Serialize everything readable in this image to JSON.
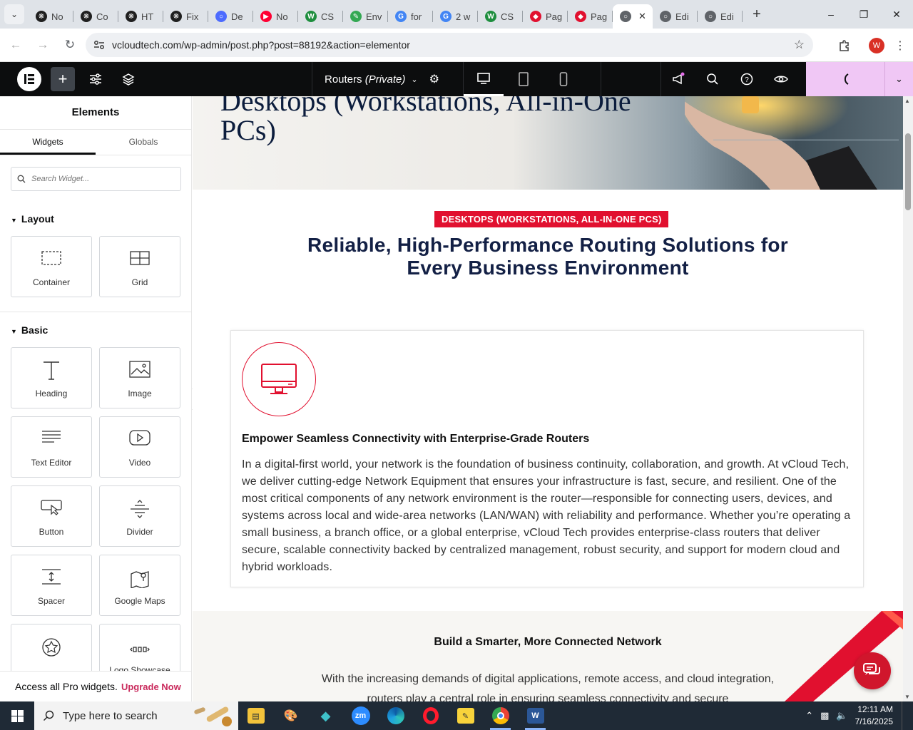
{
  "browser": {
    "tabs": [
      {
        "label": "No",
        "icon": "openai-icon",
        "color": "#1f1f1f"
      },
      {
        "label": "Co",
        "icon": "openai-icon",
        "color": "#1f1f1f"
      },
      {
        "label": "HT",
        "icon": "openai-icon",
        "color": "#1f1f1f"
      },
      {
        "label": "Fix",
        "icon": "openai-icon",
        "color": "#1f1f1f"
      },
      {
        "label": "De",
        "icon": "deepseek-icon",
        "color": "#4d6bfe"
      },
      {
        "label": "No",
        "icon": "youtube-icon",
        "color": "#ff0033"
      },
      {
        "label": "CS",
        "icon": "w-icon",
        "color": "#1e8e3e"
      },
      {
        "label": "Env",
        "icon": "envato-icon",
        "color": "#34a853"
      },
      {
        "label": "for",
        "icon": "google-icon",
        "color": "#4285f4"
      },
      {
        "label": "2 w",
        "icon": "google-icon",
        "color": "#4285f4"
      },
      {
        "label": "CS",
        "icon": "w-icon",
        "color": "#1e8e3e"
      },
      {
        "label": "Pag",
        "icon": "pagespeed-icon",
        "color": "#e1102f"
      },
      {
        "label": "Pag",
        "icon": "pagespeed-icon",
        "color": "#e1102f"
      },
      {
        "label": "",
        "icon": "globe-icon",
        "color": "#5f6368",
        "active": true
      },
      {
        "label": "Edi",
        "icon": "globe-icon",
        "color": "#5f6368"
      },
      {
        "label": "Edi",
        "icon": "globe-icon",
        "color": "#5f6368"
      }
    ],
    "url": "vcloudtech.com/wp-admin/post.php?post=88192&action=elementor",
    "profile_initial": "W"
  },
  "editor": {
    "document_title": "Routers",
    "document_status": "(Private)",
    "panel_title": "Elements",
    "panel_tabs": [
      "Widgets",
      "Globals"
    ],
    "search_placeholder": "Search Widget...",
    "categories": {
      "layout": "Layout",
      "basic": "Basic"
    },
    "layout_widgets": [
      {
        "label": "Container",
        "icon": "container-icon"
      },
      {
        "label": "Grid",
        "icon": "grid-icon"
      }
    ],
    "basic_widgets": [
      {
        "label": "Heading",
        "icon": "heading-icon"
      },
      {
        "label": "Image",
        "icon": "image-icon"
      },
      {
        "label": "Text Editor",
        "icon": "text-editor-icon"
      },
      {
        "label": "Video",
        "icon": "video-icon"
      },
      {
        "label": "Button",
        "icon": "button-icon"
      },
      {
        "label": "Divider",
        "icon": "divider-icon"
      },
      {
        "label": "Spacer",
        "icon": "spacer-icon"
      },
      {
        "label": "Google Maps",
        "icon": "google-maps-icon"
      },
      {
        "label": "",
        "icon": "star-icon"
      },
      {
        "label": "Logo Showcase",
        "icon": "logo-showcase-icon"
      }
    ],
    "promo_text": "Access all Pro widgets.",
    "promo_link": "Upgrade Now",
    "accent": "#f0c7f5"
  },
  "page": {
    "hero_title": "Desktops (Workstations, All-in-One PCs)",
    "badge": "DESKTOPS (WORKSTATIONS, ALL-IN-ONE PCS)",
    "heading": "Reliable, High-Performance Routing Solutions for Every Business Environment",
    "card_title": "Empower Seamless Connectivity with Enterprise-Grade Routers",
    "card_body": "In a digital-first world, your network is the foundation of business continuity, collaboration, and growth. At vCloud Tech, we deliver cutting-edge Network Equipment that ensures your infrastructure is fast, secure, and resilient. One of the most critical components of any network environment is the router—responsible for connecting users, devices, and systems across local and wide-area networks (LAN/WAN) with reliability and performance. Whether you’re operating a small business, a branch office, or a global enterprise, vCloud Tech provides enterprise-class routers that deliver secure, scalable connectivity backed by centralized management, robust security, and support for modern cloud and hybrid workloads.",
    "section2_title": "Build a Smarter, More Connected Network",
    "section2_body": "With the increasing demands of digital applications, remote access, and cloud integration, routers play a central role in ensuring seamless connectivity and secure",
    "accent_red": "#e1102f",
    "navy": "#132045"
  },
  "taskbar": {
    "search_placeholder": "Type here to search",
    "time": "12:11 AM",
    "date": "7/16/2025"
  }
}
